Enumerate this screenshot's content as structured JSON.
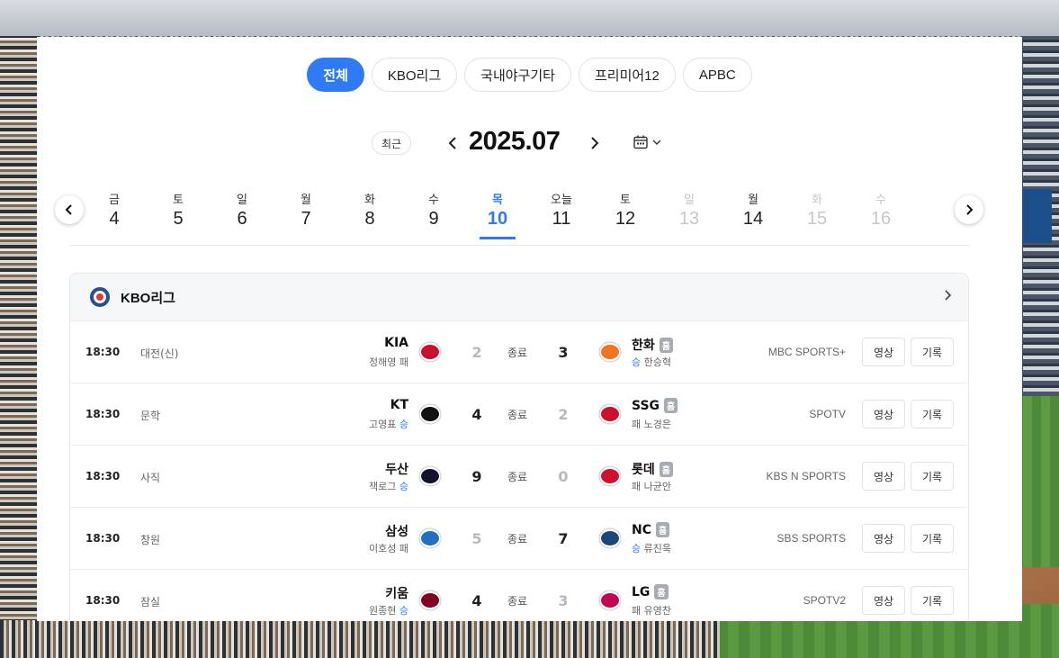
{
  "tabs": [
    {
      "label": "전체",
      "active": true
    },
    {
      "label": "KBO리그",
      "active": false
    },
    {
      "label": "국내야구기타",
      "active": false
    },
    {
      "label": "프리미어12",
      "active": false
    },
    {
      "label": "APBC",
      "active": false
    }
  ],
  "month_nav": {
    "recent_label": "최근",
    "month": "2025.07",
    "prev_icon": "chevron-left-icon",
    "next_icon": "chevron-right-icon",
    "calendar_icon": "calendar-icon"
  },
  "dates": [
    {
      "dow": "금",
      "num": "4",
      "state": "normal"
    },
    {
      "dow": "토",
      "num": "5",
      "state": "normal"
    },
    {
      "dow": "일",
      "num": "6",
      "state": "normal"
    },
    {
      "dow": "월",
      "num": "7",
      "state": "normal"
    },
    {
      "dow": "화",
      "num": "8",
      "state": "normal"
    },
    {
      "dow": "수",
      "num": "9",
      "state": "normal"
    },
    {
      "dow": "목",
      "num": "10",
      "state": "selected"
    },
    {
      "dow": "오늘",
      "num": "11",
      "state": "normal"
    },
    {
      "dow": "토",
      "num": "12",
      "state": "normal"
    },
    {
      "dow": "일",
      "num": "13",
      "state": "disabled"
    },
    {
      "dow": "월",
      "num": "14",
      "state": "normal"
    },
    {
      "dow": "화",
      "num": "15",
      "state": "disabled"
    },
    {
      "dow": "수",
      "num": "16",
      "state": "disabled"
    }
  ],
  "league": {
    "name": "KBO리그"
  },
  "games": [
    {
      "time": "18:30",
      "stadium": "대전(신)",
      "away": "KIA",
      "away_pitcher": "정해영",
      "away_result": "패",
      "away_score": "2",
      "away_win": false,
      "status": "종료",
      "home_score": "3",
      "home_win": true,
      "home": "한화",
      "home_badge": "홈",
      "home_pitcher": "한승혁",
      "home_result": "승",
      "broadcast": "MBC SPORTS+",
      "away_logo_color": "#c8102e",
      "home_logo_color": "#f37321"
    },
    {
      "time": "18:30",
      "stadium": "문학",
      "away": "KT",
      "away_pitcher": "고영표",
      "away_result": "승",
      "away_score": "4",
      "away_win": true,
      "status": "종료",
      "home_score": "2",
      "home_win": false,
      "home": "SSG",
      "home_badge": "홈",
      "home_pitcher": "노경은",
      "home_result": "패",
      "broadcast": "SPOTV",
      "away_logo_color": "#111111",
      "home_logo_color": "#ce0e2d"
    },
    {
      "time": "18:30",
      "stadium": "사직",
      "away": "두산",
      "away_pitcher": "잭로그",
      "away_result": "승",
      "away_score": "9",
      "away_win": true,
      "status": "종료",
      "home_score": "0",
      "home_win": false,
      "home": "롯데",
      "home_badge": "홈",
      "home_pitcher": "나균안",
      "home_result": "패",
      "broadcast": "KBS N SPORTS",
      "away_logo_color": "#131230",
      "home_logo_color": "#d00f31"
    },
    {
      "time": "18:30",
      "stadium": "창원",
      "away": "삼성",
      "away_pitcher": "이호성",
      "away_result": "패",
      "away_score": "5",
      "away_win": false,
      "status": "종료",
      "home_score": "7",
      "home_win": true,
      "home": "NC",
      "home_badge": "홈",
      "home_pitcher": "류진욱",
      "home_result": "승",
      "broadcast": "SBS SPORTS",
      "away_logo_color": "#1f6fc5",
      "home_logo_color": "#1d467a"
    },
    {
      "time": "18:30",
      "stadium": "잠실",
      "away": "키움",
      "away_pitcher": "원종현",
      "away_result": "승",
      "away_score": "4",
      "away_win": true,
      "status": "종료",
      "home_score": "3",
      "home_win": false,
      "home": "LG",
      "home_badge": "홈",
      "home_pitcher": "유영찬",
      "home_result": "패",
      "broadcast": "SPOTV2",
      "away_logo_color": "#820024",
      "home_logo_color": "#c30452"
    }
  ],
  "buttons": {
    "video": "영상",
    "record": "기록"
  },
  "colors": {
    "accent": "#2f7bf5",
    "win_text": "#2f7bf5",
    "dim": "#c4c7cc"
  }
}
